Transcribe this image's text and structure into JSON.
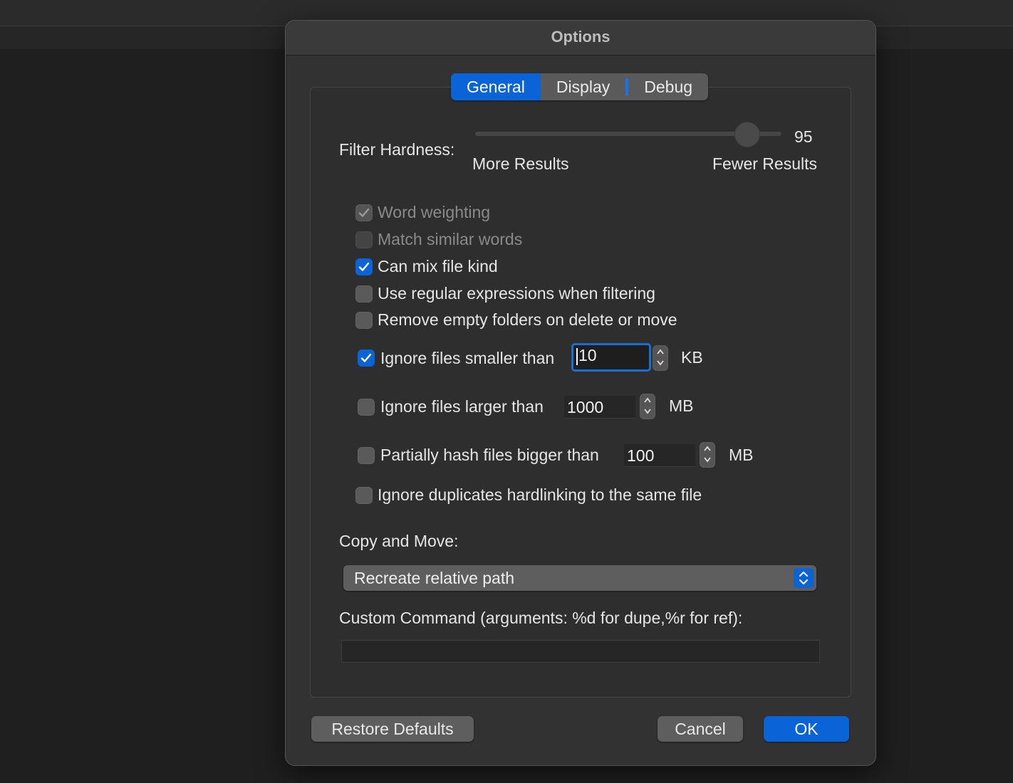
{
  "window": {
    "title": "Options"
  },
  "tabs": [
    {
      "label": "General",
      "active": true
    },
    {
      "label": "Display",
      "active": false
    },
    {
      "label": "Debug",
      "active": false
    }
  ],
  "filter": {
    "label": "Filter Hardness:",
    "value": "95",
    "min_label": "More Results",
    "max_label": "Fewer Results",
    "value_fraction": 0.92
  },
  "options": {
    "word_weighting": {
      "label": "Word weighting",
      "checked": true,
      "enabled": false
    },
    "match_similar": {
      "label": "Match similar words",
      "checked": false,
      "enabled": false
    },
    "mix_file_kind": {
      "label": "Can mix file kind",
      "checked": true,
      "enabled": true
    },
    "regex": {
      "label": "Use regular expressions when filtering",
      "checked": false,
      "enabled": true
    },
    "remove_empty": {
      "label": "Remove empty folders on delete or move",
      "checked": false,
      "enabled": true
    },
    "ignore_smaller": {
      "label": "Ignore files smaller than",
      "checked": true,
      "value": "10",
      "unit": "KB"
    },
    "ignore_larger": {
      "label": "Ignore files larger than",
      "checked": false,
      "value": "1000",
      "unit": "MB"
    },
    "partial_hash": {
      "label": "Partially hash files bigger than",
      "checked": false,
      "value": "100",
      "unit": "MB"
    },
    "hardlinks": {
      "label": "Ignore duplicates hardlinking to the same file",
      "checked": false,
      "enabled": true
    }
  },
  "copy_move": {
    "label": "Copy and Move:",
    "selected": "Recreate relative path"
  },
  "custom_command": {
    "label": "Custom Command (arguments: %d for dupe,%r for ref):",
    "value": ""
  },
  "buttons": {
    "restore": "Restore Defaults",
    "cancel": "Cancel",
    "ok": "OK"
  },
  "colors": {
    "accent": "#0a64d8",
    "dialog_bg": "#323232",
    "page_bg": "#1f1f1f"
  }
}
